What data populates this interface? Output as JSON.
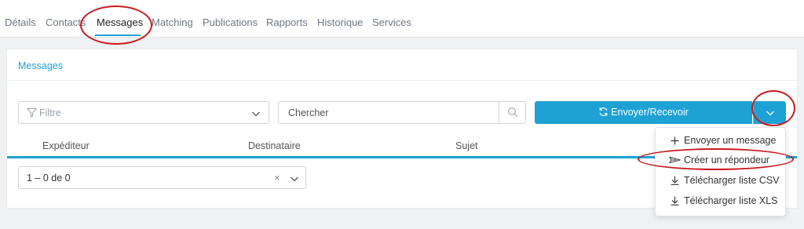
{
  "tabs": [
    {
      "label": "Détails"
    },
    {
      "label": "Contacts"
    },
    {
      "label": "Messages",
      "active": true
    },
    {
      "label": "Matching"
    },
    {
      "label": "Publications"
    },
    {
      "label": "Rapports"
    },
    {
      "label": "Historique"
    },
    {
      "label": "Services"
    }
  ],
  "panel": {
    "title": "Messages",
    "filter": {
      "placeholder": "Filtre",
      "icon": "filter-icon"
    },
    "search": {
      "placeholder": "Chercher",
      "icon": "search-icon"
    },
    "send": {
      "label": "Envoyer/Recevoir",
      "icon": "sync-icon"
    },
    "columns": [
      "Expéditeur",
      "Destinataire",
      "Sujet"
    ],
    "pager": {
      "text": "1 – 0 de 0",
      "clear": "×"
    }
  },
  "menu": {
    "items": [
      {
        "label": "Envoyer un message",
        "icon": "plus-icon"
      },
      {
        "label": "Créer un répondeur",
        "icon": "plane-icon"
      },
      {
        "label": "Télécharger liste CSV",
        "icon": "download-icon"
      },
      {
        "label": "Télécharger liste XLS",
        "icon": "download-icon"
      }
    ]
  },
  "colors": {
    "accent": "#1ea1d4",
    "highlight": "#c9191e",
    "background": "#f0f1f3"
  }
}
